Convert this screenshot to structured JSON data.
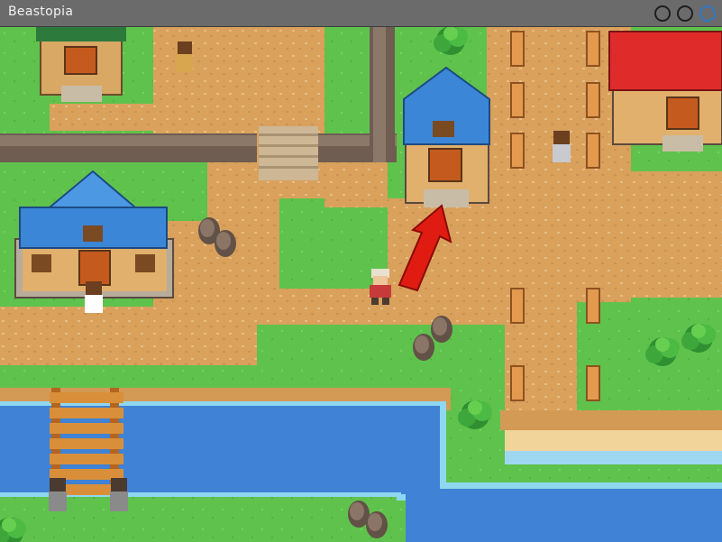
{
  "window": {
    "title": "Beastopia",
    "controls": [
      "minimize-button",
      "maximize-button",
      "close-button"
    ]
  },
  "scene": {
    "type": "top-down pixel-art town map",
    "player": "player-character",
    "hint_arrow": "red-arrow-pointing-to-blue-roof-house-door",
    "buildings": [
      "house-top-left",
      "house-blue-roof-left",
      "house-blue-roof-center",
      "house-red-roof-right"
    ],
    "npcs": [
      "npc-top",
      "npc-right",
      "npc-by-left-house",
      "npc-bridge-left",
      "npc-bridge-right"
    ]
  },
  "colors": {
    "grass": "#5fc24d",
    "path": "#d9a15c",
    "water": "#3f82d6",
    "blue_roof": "#3b86d6",
    "red_roof": "#e02b2b",
    "arrow": "#e01c12"
  }
}
